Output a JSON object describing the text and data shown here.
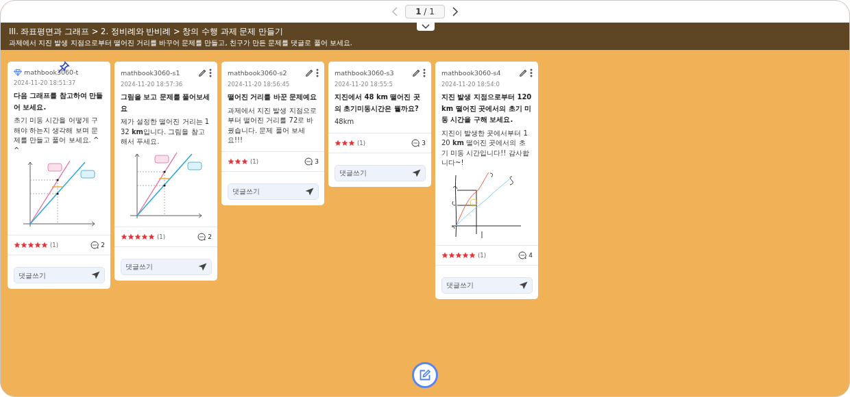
{
  "pager": {
    "current": "1",
    "separator": "/",
    "total": "1",
    "prev_disabled": true
  },
  "header_toggle": {
    "expanded": true
  },
  "header": {
    "breadcrumb": "III. 좌표평면과 그래프 > 2. 정비례와 반비례 > 창의 수행 과제 문제 만들기",
    "instruction": "과제에서 지진 발생 지점으로부터 떨어진 거리를 바꾸어 문제를 만들고, 친구가 만든 문제를 댓글로 풀어 보세요."
  },
  "cards": [
    {
      "kind": "teacher",
      "pinned": true,
      "author": "mathbook3060-t",
      "date": "2024-11-20 18:51:37",
      "title": "다음 그래프를 참고하여 만들어 보세요.",
      "body": "초기 미동 시간을 어떻게 구해야 하는지 생각해 보며 문제를 만들고 풀어 보세요. ^^",
      "stars": 5,
      "rating_count": "(1)",
      "comments": "2",
      "comment_placeholder": "댓글쓰기"
    },
    {
      "kind": "student",
      "pinned": false,
      "author": "mathbook3060-s1",
      "date": "2024-11-20 18:57:36",
      "title": "그림을 보고 문제를 풀어보세요",
      "body": "제가 설정한 떨어진 거리는 132 **km**입니다. 그림을 참고해서 푸세요.",
      "stars": 5,
      "rating_count": "(1)",
      "comments": "2",
      "comment_placeholder": "댓글쓰기"
    },
    {
      "kind": "student",
      "pinned": false,
      "author": "mathbook3060-s2",
      "date": "2024-11-20 18:56:45",
      "title": "떨어진 거리를 바꾼 문제예요",
      "body": "과제에서 지진 발생 지점으로부터 떨어진 거리를 72로 바꿨습니다. 문제 풀어 보세요!!!",
      "stars": 3,
      "rating_count": "(1)",
      "comments": "3",
      "comment_placeholder": "댓글쓰기"
    },
    {
      "kind": "student",
      "pinned": false,
      "author": "mathbook3060-s3",
      "date": "2024-11-20 18:55:5",
      "title": "지진에서 48 km 떨어진 곳의 초기미동시간은 뭘까요?",
      "body": "48km",
      "stars": 3,
      "rating_count": "(1)",
      "comments": "3",
      "comment_placeholder": "댓글쓰기"
    },
    {
      "kind": "student",
      "pinned": false,
      "author": "mathbook3060-s4",
      "date": "2024-11-20 18:54:0",
      "title": "지진 발생 지점으로부터 120 km 떨어진 곳에서의 초기 미동 시간을 구해 보세요.",
      "body": "지진이 발생한 곳에서부터 120 **km** 떨어진 곳에서의 초기 미동 시간입니다!! 감사합니다~!",
      "stars": 5,
      "rating_count": "(1)",
      "comments": "4",
      "comment_placeholder": "댓글쓰기"
    }
  ]
}
